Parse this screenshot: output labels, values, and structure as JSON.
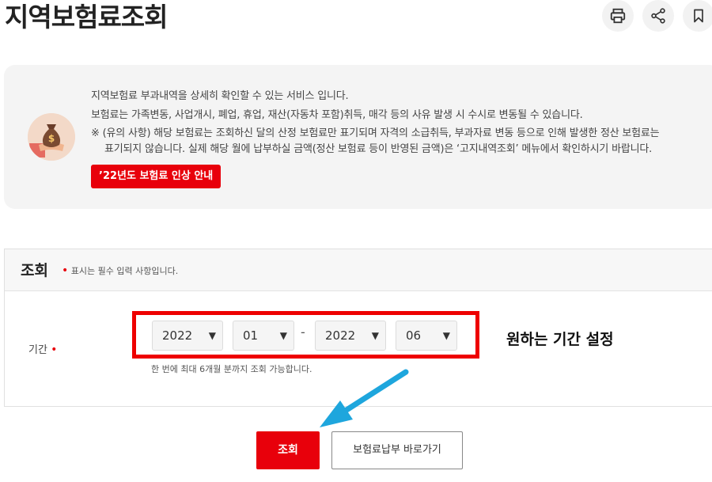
{
  "page": {
    "title": "지역보험료조회",
    "icons": [
      "printer-icon",
      "share-icon",
      "bookmark-icon"
    ]
  },
  "info": {
    "lines": [
      "지역보험료 부과내역을 상세히 확인할 수 있는 서비스 입니다.",
      "보험료는 가족변동, 사업개시, 폐업, 휴업, 재산(자동차 포함)취득, 매각 등의 사유 발생 시 수시로 변동될 수 있습니다.",
      "※ (유의 사항) 해당 보험료는 조회하신 달의 산정 보험료만 표기되며 자격의 소급취득, 부과자료 변동 등으로 인해 발생한 정산 보험료는",
      "표기되지 않습니다. 실제 해당 월에 납부하실 금액(정산 보험료 등이 반영된 금액)은 ‘고지내역조회’ 메뉴에서 확인하시기 바랍니다."
    ],
    "notice_button": "’22년도 보험료 인상 안내"
  },
  "search": {
    "title": "조회",
    "required_note": "표시는 필수 입력 사항입니다.",
    "period_label": "기간",
    "start_year": "2022",
    "start_month": "01",
    "separator": "-",
    "end_year": "2022",
    "end_month": "06",
    "hint": "한 번에 최대 6개월 분까지 조회 가능합니다.",
    "annotation": "원하는 기간 설정"
  },
  "buttons": {
    "search": "조회",
    "payment": "보험료납부 바로가기"
  },
  "colors": {
    "accent_red": "#e8000b",
    "arrow_blue": "#1ea6dd"
  }
}
